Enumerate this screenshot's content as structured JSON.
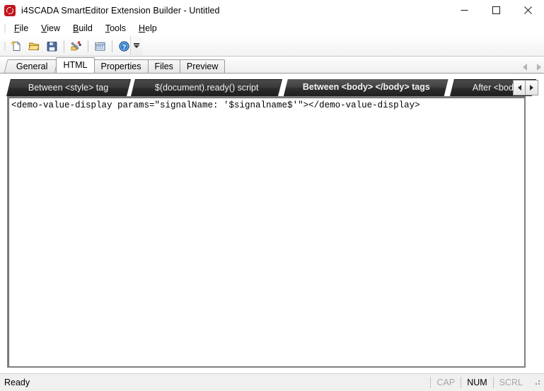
{
  "window": {
    "icon": "app-shield-icon",
    "title": "i4SCADA SmartEditor Extension Builder - Untitled",
    "minimize_label": "Minimize",
    "maximize_label": "Maximize",
    "close_label": "Close"
  },
  "menu": {
    "items": [
      {
        "label": "File",
        "mnemonic": "F"
      },
      {
        "label": "View",
        "mnemonic": "V"
      },
      {
        "label": "Build",
        "mnemonic": "B"
      },
      {
        "label": "Tools",
        "mnemonic": "T"
      },
      {
        "label": "Help",
        "mnemonic": "H"
      }
    ]
  },
  "toolbar": {
    "buttons": [
      {
        "name": "new-file-icon",
        "tooltip": "New"
      },
      {
        "name": "open-folder-icon",
        "tooltip": "Open"
      },
      {
        "name": "save-disk-icon",
        "tooltip": "Save"
      },
      {
        "name": "build-tools-icon",
        "tooltip": "Build"
      },
      {
        "name": "deploy-grid-icon",
        "tooltip": "Deploy"
      },
      {
        "name": "help-question-icon",
        "tooltip": "Help"
      }
    ],
    "overflow_label": "Toolbar Options"
  },
  "main_tabs": {
    "items": [
      {
        "label": "General",
        "active": false
      },
      {
        "label": "HTML",
        "active": true
      },
      {
        "label": "Properties",
        "active": false
      },
      {
        "label": "Files",
        "active": false
      },
      {
        "label": "Preview",
        "active": false
      }
    ],
    "scroll_left_label": "Scroll tabs left",
    "scroll_right_label": "Scroll tabs right"
  },
  "html_sections": {
    "tabs": [
      {
        "label": "Between <style> tag",
        "active": false
      },
      {
        "label": "$(document).ready() script",
        "active": false
      },
      {
        "label": "Between <body> </body> tags",
        "active": true
      },
      {
        "label": "After <bod",
        "active": false
      }
    ],
    "scroll_left_label": "Previous section",
    "scroll_right_label": "Next section"
  },
  "editor": {
    "content": "<demo-value-display params=\"signalName: '$signalname$'\"></demo-value-display>",
    "placeholder": ""
  },
  "statusbar": {
    "message": "Ready",
    "indicators": [
      {
        "label": "CAP",
        "state": "off"
      },
      {
        "label": "NUM",
        "state": "on"
      },
      {
        "label": "SCRL",
        "state": "off"
      }
    ]
  },
  "colors": {
    "accent_red": "#c0161c",
    "dark_tab": "#2e2e2e",
    "active_tab_outline": "#ffffff",
    "chrome": "#f0f0f0"
  }
}
